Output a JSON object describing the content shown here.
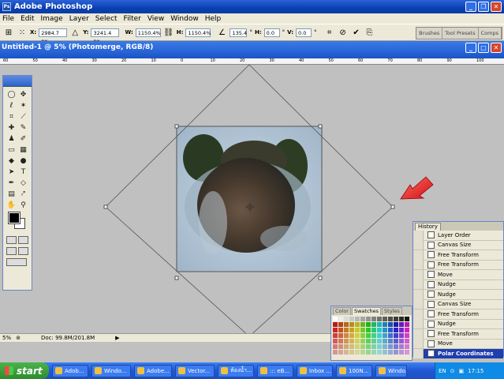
{
  "window": {
    "title": "Adobe Photoshop"
  },
  "menu": [
    "File",
    "Edit",
    "Image",
    "Layer",
    "Select",
    "Filter",
    "View",
    "Window",
    "Help"
  ],
  "options": {
    "x_label": "X:",
    "x_value": "2984.7 px",
    "y_label": "Y:",
    "y_value": "3241.4 px",
    "w_label": "W:",
    "w_value": "1150.4%",
    "h_label": "H:",
    "h_value": "1150.4%",
    "angle_value": "135.4",
    "angle_unit": "°",
    "hskew_label": "H:",
    "hskew_value": "0.0",
    "hskew_unit": "°",
    "vskew_label": "V:",
    "vskew_value": "0.0",
    "vskew_unit": "°",
    "palette_tabs": [
      "Brushes",
      "Tool Presets",
      "Comps"
    ]
  },
  "document": {
    "title": "Untitled-1 @ 5% (Photomerge, RGB/8)"
  },
  "ruler": {
    "ticks": [
      "60",
      "50",
      "40",
      "30",
      "20",
      "10",
      "0",
      "10",
      "20",
      "30",
      "40",
      "50",
      "60",
      "70",
      "80",
      "90",
      "100"
    ]
  },
  "status": {
    "zoom": "5%",
    "doc_info": "Doc: 99.8M/201.8M"
  },
  "history": {
    "tab": "History",
    "items": [
      "Layer Order",
      "Canvas Size",
      "Free Transform",
      "Free Transform",
      "Move",
      "Nudge",
      "Nudge",
      "Canvas Size",
      "Free Transform",
      "Nudge",
      "Free Transform",
      "Move",
      "Polar Coordinates"
    ],
    "selected_index": 12
  },
  "swatches": {
    "tabs": [
      "Color",
      "Swatches",
      "Styles"
    ],
    "active": "Swatches"
  },
  "taskbar": {
    "start": "start",
    "items": [
      "Adob...",
      "Windo...",
      "Adobe...",
      "Vector...",
      "ห้องน้ำ...",
      "::: eB...",
      "Inbox ...",
      "100N...",
      "Windo..."
    ],
    "tray_lang": "EN",
    "clock": "17:15"
  },
  "colors": {
    "canvas_bg": "#c0c0c0",
    "titlebar": "#0a3fb0",
    "arrow": "#e8202a",
    "selection": "#1f3fae"
  }
}
